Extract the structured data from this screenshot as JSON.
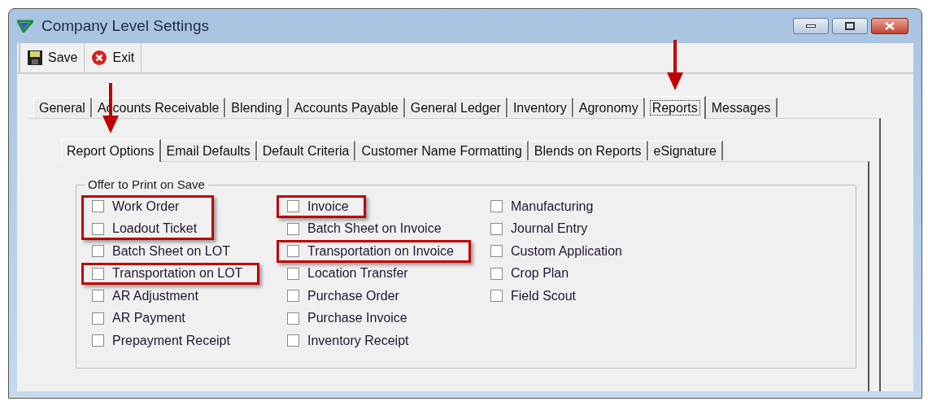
{
  "window": {
    "title": "Company Level Settings"
  },
  "toolbar": [
    {
      "label": "Save",
      "kind": "save"
    },
    {
      "label": "Exit",
      "kind": "exit"
    }
  ],
  "tabs": [
    {
      "label": "General",
      "selected": false,
      "pointed": false
    },
    {
      "label": "Accounts Receivable",
      "selected": false,
      "pointed": false
    },
    {
      "label": "Blending",
      "selected": false,
      "pointed": false
    },
    {
      "label": "Accounts Payable",
      "selected": false,
      "pointed": false
    },
    {
      "label": "General Ledger",
      "selected": false,
      "pointed": false
    },
    {
      "label": "Inventory",
      "selected": false,
      "pointed": false
    },
    {
      "label": "Agronomy",
      "selected": false,
      "pointed": false
    },
    {
      "label": "Reports",
      "selected": true,
      "pointed": true
    },
    {
      "label": "Messages",
      "selected": false,
      "pointed": false
    }
  ],
  "subtabs": [
    {
      "label": "Report Options",
      "selected": true,
      "pointed": true
    },
    {
      "label": "Email Defaults",
      "selected": false,
      "pointed": false
    },
    {
      "label": "Default Criteria",
      "selected": false,
      "pointed": false
    },
    {
      "label": "Customer Name Formatting",
      "selected": false,
      "pointed": false
    },
    {
      "label": "Blends on Reports",
      "selected": false,
      "pointed": false
    },
    {
      "label": "eSignature",
      "selected": false,
      "pointed": false
    }
  ],
  "group": {
    "title": "Offer to Print on Save",
    "columns": [
      [
        {
          "label": "Work Order",
          "checked": false,
          "highlighted": true
        },
        {
          "label": "Loadout Ticket",
          "checked": false,
          "highlighted": true
        },
        {
          "label": "Batch Sheet on LOT",
          "checked": false,
          "highlighted": false
        },
        {
          "label": "Transportation on LOT",
          "checked": false,
          "highlighted": true
        },
        {
          "label": "AR Adjustment",
          "checked": false,
          "highlighted": false
        },
        {
          "label": "AR Payment",
          "checked": false,
          "highlighted": false
        },
        {
          "label": "Prepayment Receipt",
          "checked": false,
          "highlighted": false
        }
      ],
      [
        {
          "label": "Invoice",
          "checked": false,
          "highlighted": true
        },
        {
          "label": "Batch Sheet on Invoice",
          "checked": false,
          "highlighted": false
        },
        {
          "label": "Transportation on Invoice",
          "checked": false,
          "highlighted": true
        },
        {
          "label": "Location Transfer",
          "checked": false,
          "highlighted": false
        },
        {
          "label": "Purchase Order",
          "checked": false,
          "highlighted": false
        },
        {
          "label": "Purchase Invoice",
          "checked": false,
          "highlighted": false
        },
        {
          "label": "Inventory Receipt",
          "checked": false,
          "highlighted": false
        }
      ],
      [
        {
          "label": "Manufacturing",
          "checked": false,
          "highlighted": false
        },
        {
          "label": "Journal Entry",
          "checked": false,
          "highlighted": false
        },
        {
          "label": "Custom Application",
          "checked": false,
          "highlighted": false
        },
        {
          "label": "Crop Plan",
          "checked": false,
          "highlighted": false
        },
        {
          "label": "Field Scout",
          "checked": false,
          "highlighted": false
        }
      ]
    ]
  }
}
